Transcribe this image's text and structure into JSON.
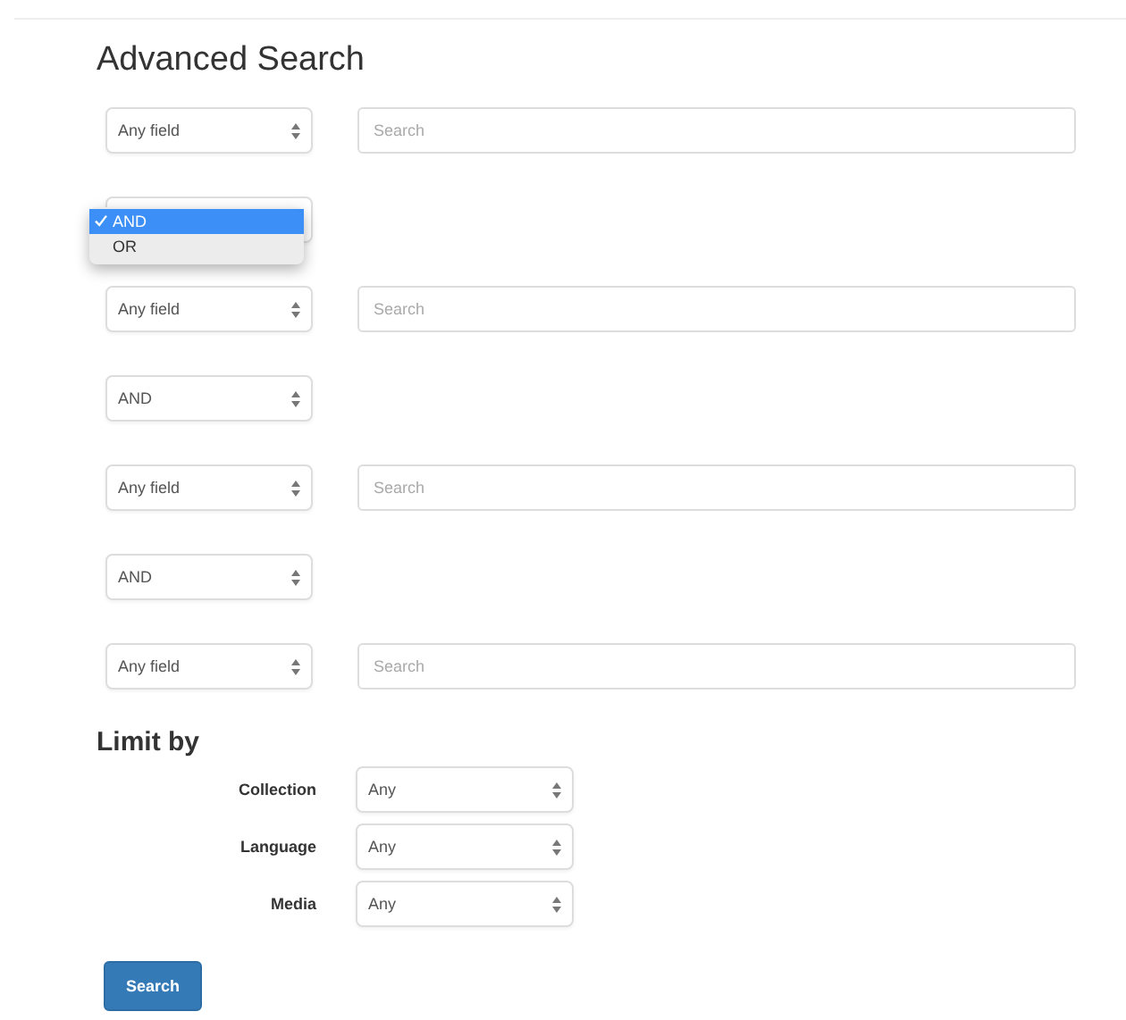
{
  "title": "Advanced Search",
  "rows": [
    {
      "kind": "field",
      "field": "Any field",
      "placeholder": "Search"
    },
    {
      "kind": "operator",
      "open": true,
      "options": [
        {
          "label": "AND",
          "selected": true
        },
        {
          "label": "OR",
          "selected": false
        }
      ]
    },
    {
      "kind": "field",
      "field": "Any field",
      "placeholder": "Search"
    },
    {
      "kind": "operator",
      "open": false,
      "value": "AND"
    },
    {
      "kind": "field",
      "field": "Any field",
      "placeholder": "Search"
    },
    {
      "kind": "operator",
      "open": false,
      "value": "AND"
    },
    {
      "kind": "field",
      "field": "Any field",
      "placeholder": "Search"
    }
  ],
  "limit_by": {
    "heading": "Limit by",
    "filters": [
      {
        "label": "Collection",
        "value": "Any"
      },
      {
        "label": "Language",
        "value": "Any"
      },
      {
        "label": "Media",
        "value": "Any"
      }
    ]
  },
  "submit": "Search"
}
